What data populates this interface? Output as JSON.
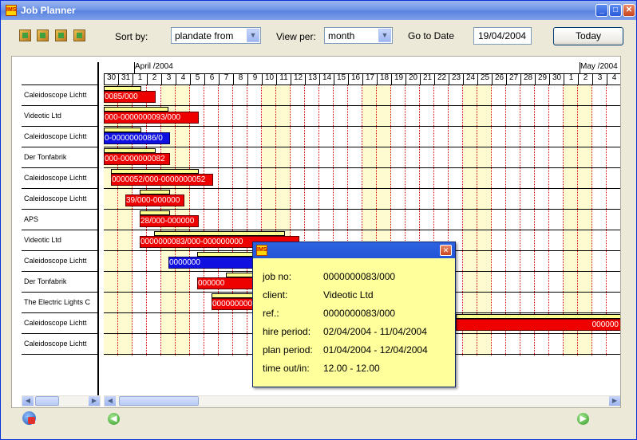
{
  "window": {
    "title": "Job Planner",
    "app_icon_text": "IMS"
  },
  "title_buttons": {
    "minimize": "_",
    "maximize": "□",
    "close": "✕"
  },
  "toolbar": {
    "icons": [
      "film-strip-icon",
      "folder-icon",
      "tray-icon",
      "export-icon"
    ],
    "sort_by_label": "Sort by:",
    "sort_by_value": "plandate from",
    "view_per_label": "View per:",
    "view_per_value": "month",
    "goto_label": "Go to Date",
    "goto_value": "19/04/2004",
    "today_label": "Today"
  },
  "calendar": {
    "months": [
      {
        "label": "April /2004",
        "start_index": 2
      },
      {
        "label": "May /2004",
        "start_index": 33
      }
    ],
    "days": [
      "30",
      "31",
      "1",
      "2",
      "3",
      "4",
      "5",
      "6",
      "7",
      "8",
      "9",
      "10",
      "11",
      "12",
      "13",
      "14",
      "15",
      "16",
      "17",
      "18",
      "19",
      "20",
      "21",
      "22",
      "23",
      "24",
      "25",
      "26",
      "27",
      "28",
      "29",
      "30",
      "1",
      "2",
      "3",
      "4"
    ],
    "weekend_indices": [
      0,
      1,
      4,
      5,
      11,
      12,
      18,
      19,
      25,
      26,
      32,
      33
    ],
    "rows": [
      "Caleidoscope Lichtt",
      "Videotic Ltd",
      "Caleidoscope Lichtt",
      "Der Tonfabrik",
      "Caleidoscope Lichtt",
      "Caleidoscope Lichtt",
      "APS",
      "Videotic Ltd",
      "Caleidoscope Lichtt",
      "Der Tonfabrik",
      "The Electric Lights C",
      "Caleidoscope Lichtt",
      "Caleidoscope Lichtt"
    ],
    "bars": [
      {
        "row": 0,
        "start": 0,
        "end": 3.6,
        "label": "0085/000",
        "color": "red",
        "hire_start": 0,
        "hire_end": 2.6
      },
      {
        "row": 1,
        "start": 0,
        "end": 6.6,
        "label": "000-0000000093/000",
        "color": "red",
        "hire_start": 0,
        "hire_end": 4.5
      },
      {
        "row": 2,
        "start": 0,
        "end": 4.6,
        "label": "0-0000000086/0",
        "color": "blue",
        "hire_start": 0,
        "hire_end": 2.6
      },
      {
        "row": 3,
        "start": 0,
        "end": 4.6,
        "label": "000-0000000082",
        "color": "red",
        "hire_start": 0,
        "hire_end": 3.6
      },
      {
        "row": 4,
        "start": 0.5,
        "end": 7.6,
        "label": "0000052/000-0000000052",
        "color": "red",
        "hire_start": 0.5,
        "hire_end": 6.6
      },
      {
        "row": 5,
        "start": 1.5,
        "end": 5.6,
        "label": "39/000-000000",
        "color": "red",
        "hire_start": 2.5,
        "hire_end": 4.6
      },
      {
        "row": 6,
        "start": 2.5,
        "end": 6.6,
        "label": "28/000-000000",
        "color": "red",
        "hire_start": 2.5,
        "hire_end": 4.6
      },
      {
        "row": 7,
        "start": 2.5,
        "end": 13.6,
        "label": "0000000083/000-000000000",
        "color": "red",
        "hire_start": 3.5,
        "hire_end": 12.6
      },
      {
        "row": 8,
        "start": 4.5,
        "end": 14.6,
        "label": "0000000",
        "color": "blue",
        "hire_start": 6.5,
        "hire_end": 14.6
      },
      {
        "row": 9,
        "start": 6.5,
        "end": 14.6,
        "label": "000000",
        "color": "red",
        "hire_start": 8.5,
        "hire_end": 14.6
      },
      {
        "row": 10,
        "start": 7.5,
        "end": 14.6,
        "label": "000000000",
        "color": "red",
        "hire_start": 7.5,
        "hire_end": 14.6
      },
      {
        "row": 11,
        "start": 24.5,
        "end": 36,
        "label": "000000",
        "color": "red",
        "hire_start": 24.5,
        "hire_end": 36
      }
    ]
  },
  "popup": {
    "icon_text": "IMS",
    "close_label": "✕",
    "fields": [
      {
        "key": "job no:",
        "value": "0000000083/000"
      },
      {
        "key": "client:",
        "value": "Videotic Ltd"
      },
      {
        "key": "ref.:",
        "value": "0000000083/000"
      },
      {
        "key": "hire period:",
        "value": "02/04/2004 - 11/04/2004"
      },
      {
        "key": "plan period:",
        "value": "01/04/2004 - 12/04/2004"
      },
      {
        "key": "time out/in:",
        "value": "12.00 - 12.00"
      }
    ]
  },
  "nav": {
    "prev": "◀",
    "next": "▶",
    "scroll_left": "◀",
    "scroll_right": "▶"
  }
}
